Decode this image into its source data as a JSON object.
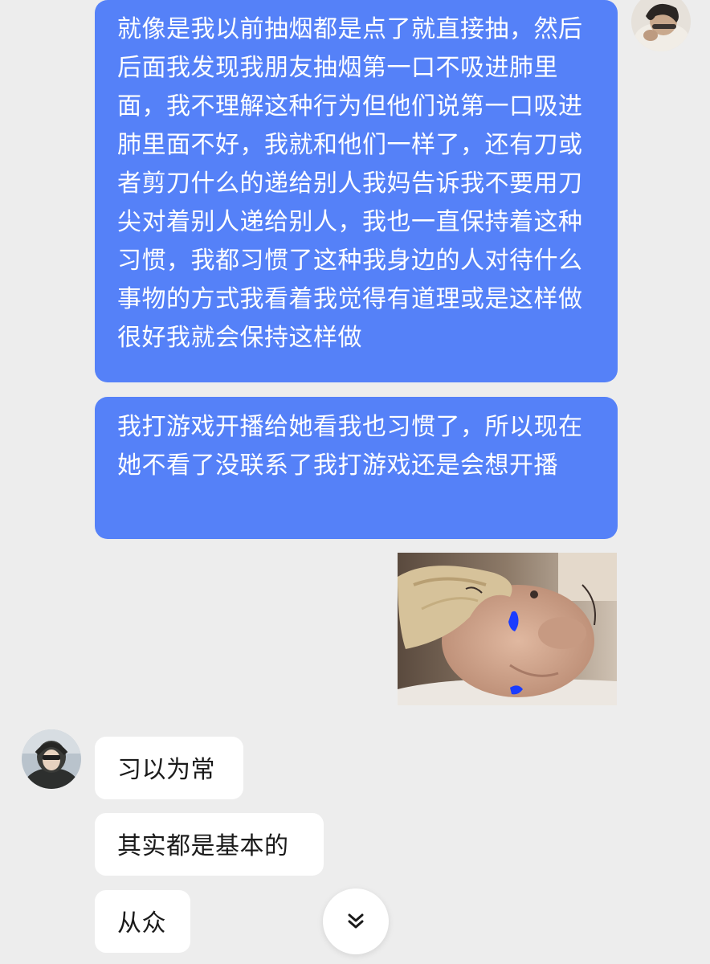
{
  "messages": {
    "outgoing": [
      {
        "text": "就像是我以前抽烟都是点了就直接抽，然后后面我发现我朋友抽烟第一口不吸进肺里面，我不理解这种行为但他们说第一口吸进肺里面不好，我就和他们一样了，还有刀或者剪刀什么的递给别人我妈告诉我不要用刀尖对着别人递给别人，我也一直保持着这种习惯，我都习惯了这种我身边的人对待什么事物的方式我看着我觉得有道理或是这样做很好我就会保持这样做"
      },
      {
        "text": "我打游戏开播给她看我也习惯了，所以现在她不看了没联系了我打游戏还是会想开播"
      }
    ],
    "incoming": [
      {
        "text": "习以为常"
      },
      {
        "text": "其实都是基本的"
      },
      {
        "text": "从众"
      }
    ]
  },
  "icons": {
    "scroll_down": "double-chevron-down-icon"
  },
  "colors": {
    "background": "#ededed",
    "outgoing_bubble": "#5581f8",
    "incoming_bubble": "#ffffff",
    "photo_scribble": "#1a3cff"
  }
}
